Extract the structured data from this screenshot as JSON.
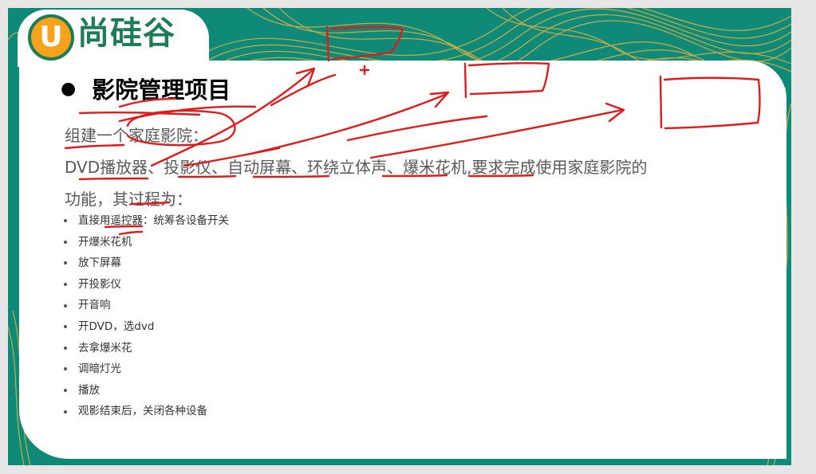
{
  "logo": {
    "initial": "U",
    "brand": "尚硅谷"
  },
  "heading": {
    "bullet": "●",
    "title": "影院管理项目"
  },
  "paragraph": {
    "line1": "组建一个家庭影院：",
    "line2": "DVD播放器、投影仪、自动屏幕、环绕立体声、爆米花机,要求完成使用家庭影院的",
    "line3": "功能，其过程为："
  },
  "steps": [
    "直接用遥控器：统筹各设备开关",
    "开爆米花机",
    "放下屏幕",
    "开投影仪",
    "开音响",
    "开DVD，选dvd",
    "去拿爆米花",
    "调暗灯光",
    "播放",
    "观影结束后，关闭各种设备"
  ],
  "colors": {
    "background_teal": "#0f8a79",
    "pattern_gold": "#e8b23a",
    "logo_orange": "#f6a21a",
    "logo_green": "#1b7c57",
    "annotation_red": "#e01b1b"
  }
}
